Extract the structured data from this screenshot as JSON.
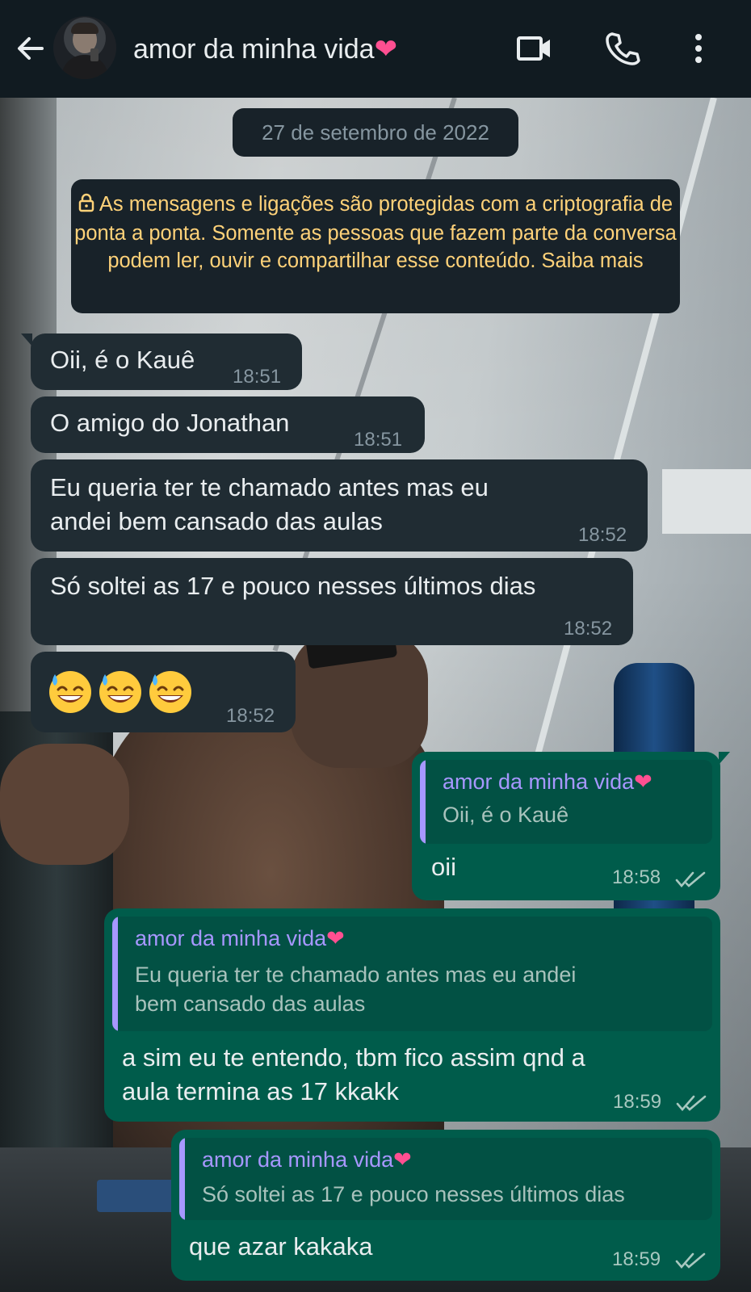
{
  "header": {
    "contact_name": "amor da minha vida",
    "heart": "❤",
    "back_icon": "arrow-left-icon",
    "video_icon": "video-call-icon",
    "call_icon": "phone-icon",
    "menu_icon": "more-vertical-icon"
  },
  "date_chip": "27 de setembro de 2022",
  "encryption_notice": "As mensagens e ligações são protegidas com a criptografia de ponta a ponta. Somente as pessoas que fazem parte da conversa podem ler, ouvir e compartilhar esse conteúdo. Saiba mais",
  "messages": [
    {
      "dir": "in",
      "text": "Oii, é o Kauê",
      "time": "18:51"
    },
    {
      "dir": "in",
      "text": "O amigo do Jonathan",
      "time": "18:51"
    },
    {
      "dir": "in",
      "text": "Eu queria ter te chamado antes mas  eu\nandei bem cansado das aulas",
      "time": "18:52"
    },
    {
      "dir": "in",
      "text": "Só soltei as 17 e pouco nesses últimos dias",
      "time": "18:52"
    },
    {
      "dir": "in",
      "emoji": "😅😅😅",
      "time": "18:52"
    },
    {
      "dir": "out",
      "quote_author": "amor da minha vida",
      "quote_text": "Oii, é o Kauê",
      "text": "oii",
      "time": "18:58",
      "status": "read"
    },
    {
      "dir": "out",
      "quote_author": "amor da minha vida",
      "quote_text": "Eu queria ter te chamado antes mas  eu andei\nbem cansado das aulas",
      "text": "a sim eu te entendo, tbm fico assim qnd a\naula termina as 17 kkakk",
      "time": "18:59",
      "status": "read"
    },
    {
      "dir": "out",
      "quote_author": "amor da minha vida",
      "quote_text": "Só soltei as 17 e pouco nesses últimos dias",
      "text": "que azar kakaka",
      "time": "18:59",
      "status": "read"
    }
  ],
  "colors": {
    "header_bg": "#111b21",
    "incoming_bubble": "#202c33",
    "outgoing_bubble": "#005c4b",
    "quote_author": "#a797ff",
    "encryption_text": "#ffd279"
  }
}
